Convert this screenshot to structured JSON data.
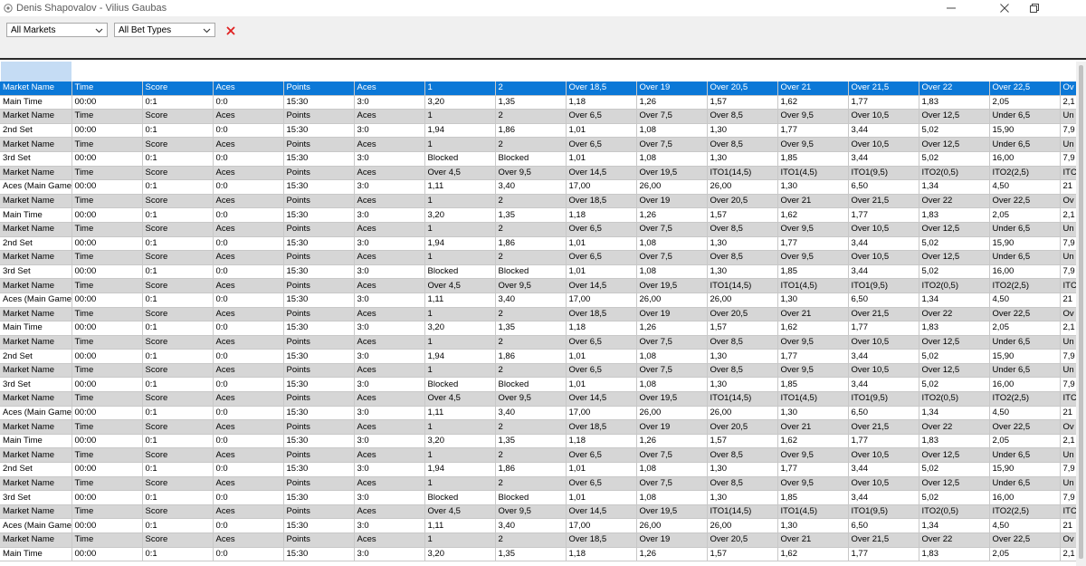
{
  "window": {
    "title": "Denis Shapovalov - Vilius Gaubas"
  },
  "filters": {
    "markets": {
      "selected": "All Markets"
    },
    "bet_types": {
      "selected": "All Bet Types"
    }
  },
  "icons": {
    "clear": "close-icon",
    "chevron": "chevron-down-icon"
  },
  "colors": {
    "selected_header": "#0b78d7",
    "group_header": "#d6d6d6",
    "clear_icon": "#e02020"
  },
  "grid": {
    "columns": [
      "Market Name",
      "Time",
      "Score",
      "Aces",
      "Points",
      "Aces",
      "1",
      "2",
      "Over 18,5",
      "Over 19",
      "Over 20,5",
      "Over 21",
      "Over 21,5",
      "Over 22",
      "Over 22,5",
      "Ov"
    ],
    "rows": [
      {
        "kind": "hdr-blue",
        "cells": [
          "Market Name",
          "Time",
          "Score",
          "Aces",
          "Points",
          "Aces",
          "1",
          "2",
          "Over 18,5",
          "Over 19",
          "Over 20,5",
          "Over 21",
          "Over 21,5",
          "Over 22",
          "Over 22,5",
          "Ov"
        ]
      },
      {
        "kind": "data",
        "cells": [
          "Main Time",
          "00:00",
          "0:1",
          "0:0",
          "15:30",
          "3:0",
          "3,20",
          "1,35",
          "1,18",
          "1,26",
          "1,57",
          "1,62",
          "1,77",
          "1,83",
          "2,05",
          "2,1"
        ]
      },
      {
        "kind": "hdr-grey",
        "cells": [
          "Market Name",
          "Time",
          "Score",
          "Aces",
          "Points",
          "Aces",
          "1",
          "2",
          "Over 6,5",
          "Over 7,5",
          "Over 8,5",
          "Over 9,5",
          "Over 10,5",
          "Over 12,5",
          "Under 6,5",
          "Un"
        ]
      },
      {
        "kind": "data",
        "cells": [
          "2nd Set",
          "00:00",
          "0:1",
          "0:0",
          "15:30",
          "3:0",
          "1,94",
          "1,86",
          "1,01",
          "1,08",
          "1,30",
          "1,77",
          "3,44",
          "5,02",
          "15,90",
          "7,9"
        ]
      },
      {
        "kind": "hdr-grey",
        "cells": [
          "Market Name",
          "Time",
          "Score",
          "Aces",
          "Points",
          "Aces",
          "1",
          "2",
          "Over 6,5",
          "Over 7,5",
          "Over 8,5",
          "Over 9,5",
          "Over 10,5",
          "Over 12,5",
          "Under 6,5",
          "Un"
        ]
      },
      {
        "kind": "data",
        "cells": [
          "3rd Set",
          "00:00",
          "0:1",
          "0:0",
          "15:30",
          "3:0",
          "Blocked",
          "Blocked",
          "1,01",
          "1,08",
          "1,30",
          "1,85",
          "3,44",
          "5,02",
          "16,00",
          "7,9"
        ]
      },
      {
        "kind": "hdr-grey",
        "cells": [
          "Market Name",
          "Time",
          "Score",
          "Aces",
          "Points",
          "Aces",
          "Over 4,5",
          "Over 9,5",
          "Over 14,5",
          "Over 19,5",
          "ITO1(14,5)",
          "ITO1(4,5)",
          "ITO1(9,5)",
          "ITO2(0,5)",
          "ITO2(2,5)",
          "ITC"
        ]
      },
      {
        "kind": "data",
        "cells": [
          "Aces (Main Game)",
          "00:00",
          "0:1",
          "0:0",
          "15:30",
          "3:0",
          "1,11",
          "3,40",
          "17,00",
          "26,00",
          "26,00",
          "1,30",
          "6,50",
          "1,34",
          "4,50",
          "21"
        ]
      },
      {
        "kind": "hdr-grey",
        "cells": [
          "Market Name",
          "Time",
          "Score",
          "Aces",
          "Points",
          "Aces",
          "1",
          "2",
          "Over 18,5",
          "Over 19",
          "Over 20,5",
          "Over 21",
          "Over 21,5",
          "Over 22",
          "Over 22,5",
          "Ov"
        ]
      },
      {
        "kind": "data",
        "cells": [
          "Main Time",
          "00:00",
          "0:1",
          "0:0",
          "15:30",
          "3:0",
          "3,20",
          "1,35",
          "1,18",
          "1,26",
          "1,57",
          "1,62",
          "1,77",
          "1,83",
          "2,05",
          "2,1"
        ]
      },
      {
        "kind": "hdr-grey",
        "cells": [
          "Market Name",
          "Time",
          "Score",
          "Aces",
          "Points",
          "Aces",
          "1",
          "2",
          "Over 6,5",
          "Over 7,5",
          "Over 8,5",
          "Over 9,5",
          "Over 10,5",
          "Over 12,5",
          "Under 6,5",
          "Un"
        ]
      },
      {
        "kind": "data",
        "cells": [
          "2nd Set",
          "00:00",
          "0:1",
          "0:0",
          "15:30",
          "3:0",
          "1,94",
          "1,86",
          "1,01",
          "1,08",
          "1,30",
          "1,77",
          "3,44",
          "5,02",
          "15,90",
          "7,9"
        ]
      },
      {
        "kind": "hdr-grey",
        "cells": [
          "Market Name",
          "Time",
          "Score",
          "Aces",
          "Points",
          "Aces",
          "1",
          "2",
          "Over 6,5",
          "Over 7,5",
          "Over 8,5",
          "Over 9,5",
          "Over 10,5",
          "Over 12,5",
          "Under 6,5",
          "Un"
        ]
      },
      {
        "kind": "data",
        "cells": [
          "3rd Set",
          "00:00",
          "0:1",
          "0:0",
          "15:30",
          "3:0",
          "Blocked",
          "Blocked",
          "1,01",
          "1,08",
          "1,30",
          "1,85",
          "3,44",
          "5,02",
          "16,00",
          "7,9"
        ]
      },
      {
        "kind": "hdr-grey",
        "cells": [
          "Market Name",
          "Time",
          "Score",
          "Aces",
          "Points",
          "Aces",
          "Over 4,5",
          "Over 9,5",
          "Over 14,5",
          "Over 19,5",
          "ITO1(14,5)",
          "ITO1(4,5)",
          "ITO1(9,5)",
          "ITO2(0,5)",
          "ITO2(2,5)",
          "ITC"
        ]
      },
      {
        "kind": "data",
        "cells": [
          "Aces (Main Game)",
          "00:00",
          "0:1",
          "0:0",
          "15:30",
          "3:0",
          "1,11",
          "3,40",
          "17,00",
          "26,00",
          "26,00",
          "1,30",
          "6,50",
          "1,34",
          "4,50",
          "21"
        ]
      },
      {
        "kind": "hdr-grey",
        "cells": [
          "Market Name",
          "Time",
          "Score",
          "Aces",
          "Points",
          "Aces",
          "1",
          "2",
          "Over 18,5",
          "Over 19",
          "Over 20,5",
          "Over 21",
          "Over 21,5",
          "Over 22",
          "Over 22,5",
          "Ov"
        ]
      },
      {
        "kind": "data",
        "cells": [
          "Main Time",
          "00:00",
          "0:1",
          "0:0",
          "15:30",
          "3:0",
          "3,20",
          "1,35",
          "1,18",
          "1,26",
          "1,57",
          "1,62",
          "1,77",
          "1,83",
          "2,05",
          "2,1"
        ]
      },
      {
        "kind": "hdr-grey",
        "cells": [
          "Market Name",
          "Time",
          "Score",
          "Aces",
          "Points",
          "Aces",
          "1",
          "2",
          "Over 6,5",
          "Over 7,5",
          "Over 8,5",
          "Over 9,5",
          "Over 10,5",
          "Over 12,5",
          "Under 6,5",
          "Un"
        ]
      },
      {
        "kind": "data",
        "cells": [
          "2nd Set",
          "00:00",
          "0:1",
          "0:0",
          "15:30",
          "3:0",
          "1,94",
          "1,86",
          "1,01",
          "1,08",
          "1,30",
          "1,77",
          "3,44",
          "5,02",
          "15,90",
          "7,9"
        ]
      },
      {
        "kind": "hdr-grey",
        "cells": [
          "Market Name",
          "Time",
          "Score",
          "Aces",
          "Points",
          "Aces",
          "1",
          "2",
          "Over 6,5",
          "Over 7,5",
          "Over 8,5",
          "Over 9,5",
          "Over 10,5",
          "Over 12,5",
          "Under 6,5",
          "Un"
        ]
      },
      {
        "kind": "data",
        "cells": [
          "3rd Set",
          "00:00",
          "0:1",
          "0:0",
          "15:30",
          "3:0",
          "Blocked",
          "Blocked",
          "1,01",
          "1,08",
          "1,30",
          "1,85",
          "3,44",
          "5,02",
          "16,00",
          "7,9"
        ]
      },
      {
        "kind": "hdr-grey",
        "cells": [
          "Market Name",
          "Time",
          "Score",
          "Aces",
          "Points",
          "Aces",
          "Over 4,5",
          "Over 9,5",
          "Over 14,5",
          "Over 19,5",
          "ITO1(14,5)",
          "ITO1(4,5)",
          "ITO1(9,5)",
          "ITO2(0,5)",
          "ITO2(2,5)",
          "ITC"
        ]
      },
      {
        "kind": "data",
        "cells": [
          "Aces (Main Game)",
          "00:00",
          "0:1",
          "0:0",
          "15:30",
          "3:0",
          "1,11",
          "3,40",
          "17,00",
          "26,00",
          "26,00",
          "1,30",
          "6,50",
          "1,34",
          "4,50",
          "21"
        ]
      },
      {
        "kind": "hdr-grey",
        "cells": [
          "Market Name",
          "Time",
          "Score",
          "Aces",
          "Points",
          "Aces",
          "1",
          "2",
          "Over 18,5",
          "Over 19",
          "Over 20,5",
          "Over 21",
          "Over 21,5",
          "Over 22",
          "Over 22,5",
          "Ov"
        ]
      },
      {
        "kind": "data",
        "cells": [
          "Main Time",
          "00:00",
          "0:1",
          "0:0",
          "15:30",
          "3:0",
          "3,20",
          "1,35",
          "1,18",
          "1,26",
          "1,57",
          "1,62",
          "1,77",
          "1,83",
          "2,05",
          "2,1"
        ]
      },
      {
        "kind": "hdr-grey",
        "cells": [
          "Market Name",
          "Time",
          "Score",
          "Aces",
          "Points",
          "Aces",
          "1",
          "2",
          "Over 6,5",
          "Over 7,5",
          "Over 8,5",
          "Over 9,5",
          "Over 10,5",
          "Over 12,5",
          "Under 6,5",
          "Un"
        ]
      },
      {
        "kind": "data",
        "cells": [
          "2nd Set",
          "00:00",
          "0:1",
          "0:0",
          "15:30",
          "3:0",
          "1,94",
          "1,86",
          "1,01",
          "1,08",
          "1,30",
          "1,77",
          "3,44",
          "5,02",
          "15,90",
          "7,9"
        ]
      },
      {
        "kind": "hdr-grey",
        "cells": [
          "Market Name",
          "Time",
          "Score",
          "Aces",
          "Points",
          "Aces",
          "1",
          "2",
          "Over 6,5",
          "Over 7,5",
          "Over 8,5",
          "Over 9,5",
          "Over 10,5",
          "Over 12,5",
          "Under 6,5",
          "Un"
        ]
      },
      {
        "kind": "data",
        "cells": [
          "3rd Set",
          "00:00",
          "0:1",
          "0:0",
          "15:30",
          "3:0",
          "Blocked",
          "Blocked",
          "1,01",
          "1,08",
          "1,30",
          "1,85",
          "3,44",
          "5,02",
          "16,00",
          "7,9"
        ]
      },
      {
        "kind": "hdr-grey",
        "cells": [
          "Market Name",
          "Time",
          "Score",
          "Aces",
          "Points",
          "Aces",
          "Over 4,5",
          "Over 9,5",
          "Over 14,5",
          "Over 19,5",
          "ITO1(14,5)",
          "ITO1(4,5)",
          "ITO1(9,5)",
          "ITO2(0,5)",
          "ITO2(2,5)",
          "ITC"
        ]
      },
      {
        "kind": "data",
        "cells": [
          "Aces (Main Game)",
          "00:00",
          "0:1",
          "0:0",
          "15:30",
          "3:0",
          "1,11",
          "3,40",
          "17,00",
          "26,00",
          "26,00",
          "1,30",
          "6,50",
          "1,34",
          "4,50",
          "21"
        ]
      },
      {
        "kind": "hdr-grey",
        "cells": [
          "Market Name",
          "Time",
          "Score",
          "Aces",
          "Points",
          "Aces",
          "1",
          "2",
          "Over 18,5",
          "Over 19",
          "Over 20,5",
          "Over 21",
          "Over 21,5",
          "Over 22",
          "Over 22,5",
          "Ov"
        ]
      },
      {
        "kind": "data",
        "cells": [
          "Main Time",
          "00:00",
          "0:1",
          "0:0",
          "15:30",
          "3:0",
          "3,20",
          "1,35",
          "1,18",
          "1,26",
          "1,57",
          "1,62",
          "1,77",
          "1,83",
          "2,05",
          "2,1"
        ]
      }
    ]
  }
}
